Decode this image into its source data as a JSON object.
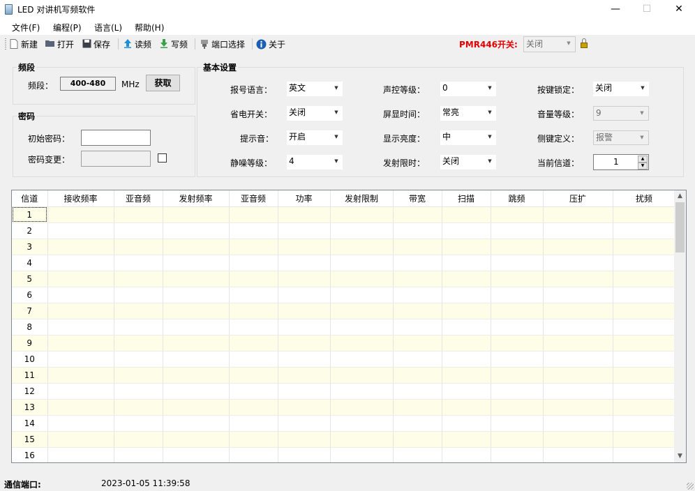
{
  "window": {
    "title": "LED 对讲机写频软件",
    "minimize": "—",
    "maximize": "☐",
    "close": "✕"
  },
  "menu": [
    {
      "label": "文件(F)"
    },
    {
      "label": "编程(P)"
    },
    {
      "label": "语言(L)"
    },
    {
      "label": "帮助(H)"
    }
  ],
  "toolbar": {
    "new": "新建",
    "open": "打开",
    "save": "保存",
    "read": "读频",
    "write": "写频",
    "port": "端口选择",
    "about": "关于",
    "pmr_label": "PMR446开关:",
    "pmr_value": "关闭"
  },
  "freq_band": {
    "title": "频段",
    "label": "频段：",
    "value": "400-480",
    "unit": "MHz",
    "fetch_button": "获取"
  },
  "password": {
    "title": "密码",
    "initial_label": "初始密码：",
    "initial_value": "",
    "change_label": "密码变更：",
    "change_value": "",
    "change_checked": false
  },
  "basic": {
    "title": "基本设置",
    "voice_lang": {
      "label": "报号语言：",
      "value": "英文"
    },
    "power_save": {
      "label": "省电开关：",
      "value": "关闭"
    },
    "prompt_tone": {
      "label": "提示音：",
      "value": "开启"
    },
    "squelch": {
      "label": "静噪等级：",
      "value": "4"
    },
    "vox_level": {
      "label": "声控等级：",
      "value": "0"
    },
    "display_time": {
      "label": "屏显时间：",
      "value": "常亮"
    },
    "brightness": {
      "label": "显示亮度：",
      "value": "中"
    },
    "tx_limit": {
      "label": "发射限时：",
      "value": "关闭"
    },
    "key_lock": {
      "label": "按键锁定：",
      "value": "关闭"
    },
    "volume": {
      "label": "音量等级：",
      "value": "9"
    },
    "side_key": {
      "label": "侧键定义：",
      "value": "报警"
    },
    "current_channel": {
      "label": "当前信道：",
      "value": "1"
    }
  },
  "grid": {
    "columns": [
      "信道",
      "接收频率",
      "亚音频",
      "发射频率",
      "亚音频",
      "功率",
      "发射限制",
      "带宽",
      "扫描",
      "跳频",
      "压扩",
      "扰频"
    ],
    "rows": [
      {
        "channel": "1"
      },
      {
        "channel": "2"
      },
      {
        "channel": "3"
      },
      {
        "channel": "4"
      },
      {
        "channel": "5"
      },
      {
        "channel": "6"
      },
      {
        "channel": "7"
      },
      {
        "channel": "8"
      },
      {
        "channel": "9"
      },
      {
        "channel": "10"
      },
      {
        "channel": "11"
      },
      {
        "channel": "12"
      },
      {
        "channel": "13"
      },
      {
        "channel": "14"
      },
      {
        "channel": "15"
      },
      {
        "channel": "16"
      }
    ]
  },
  "status": {
    "port_label": "通信端口:",
    "datetime": "2023-01-05 11:39:58"
  }
}
